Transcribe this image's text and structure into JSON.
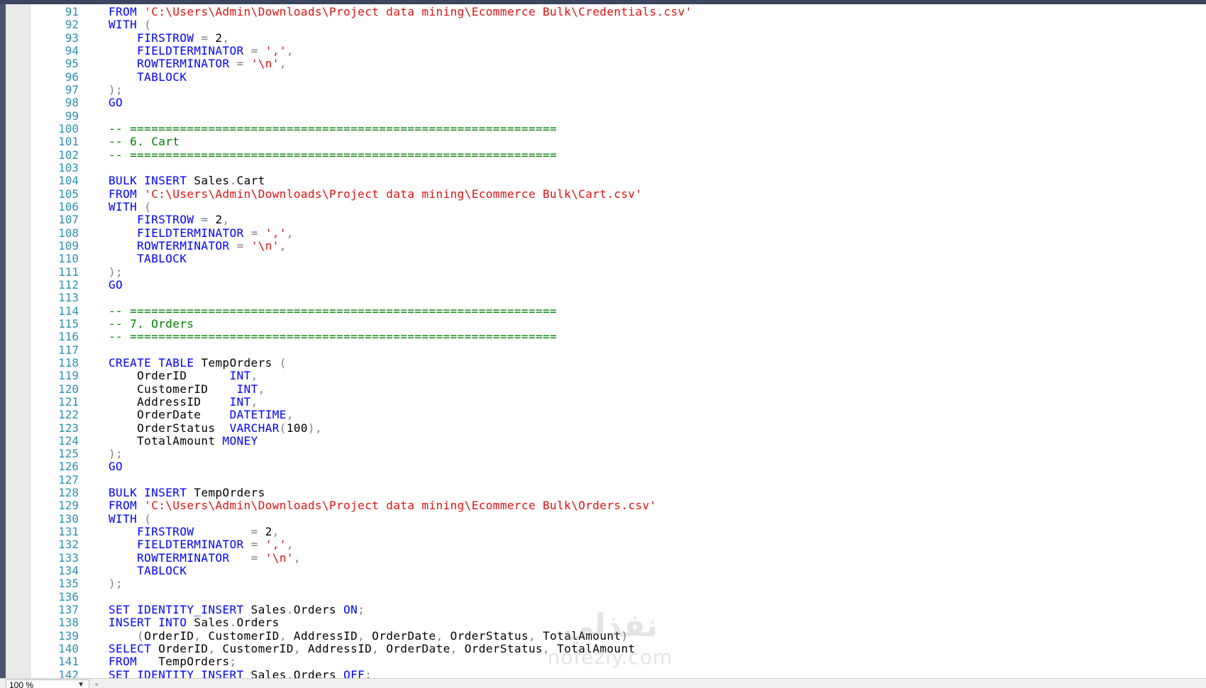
{
  "editor": {
    "lines": [
      {
        "n": "91",
        "tokens": [
          [
            "kw",
            "FROM"
          ],
          [
            "id",
            " "
          ],
          [
            "str",
            "'C:\\Users\\Admin\\Downloads\\Project data mining\\Ecommerce Bulk\\Credentials.csv'"
          ]
        ]
      },
      {
        "n": "92",
        "tokens": [
          [
            "kw",
            "WITH"
          ],
          [
            "id",
            " "
          ],
          [
            "op",
            "("
          ]
        ]
      },
      {
        "n": "93",
        "tokens": [
          [
            "id",
            "    "
          ],
          [
            "kw",
            "FIRSTROW"
          ],
          [
            "id",
            " "
          ],
          [
            "op",
            "="
          ],
          [
            "id",
            " 2"
          ],
          [
            "op",
            ","
          ]
        ]
      },
      {
        "n": "94",
        "tokens": [
          [
            "id",
            "    "
          ],
          [
            "kw",
            "FIELDTERMINATOR"
          ],
          [
            "id",
            " "
          ],
          [
            "op",
            "="
          ],
          [
            "id",
            " "
          ],
          [
            "str",
            "','"
          ],
          [
            "op",
            ","
          ]
        ]
      },
      {
        "n": "95",
        "tokens": [
          [
            "id",
            "    "
          ],
          [
            "kw",
            "ROWTERMINATOR"
          ],
          [
            "id",
            " "
          ],
          [
            "op",
            "="
          ],
          [
            "id",
            " "
          ],
          [
            "str",
            "'\\n'"
          ],
          [
            "op",
            ","
          ]
        ]
      },
      {
        "n": "96",
        "tokens": [
          [
            "id",
            "    "
          ],
          [
            "kw",
            "TABLOCK"
          ]
        ]
      },
      {
        "n": "97",
        "tokens": [
          [
            "op",
            ");"
          ]
        ]
      },
      {
        "n": "98",
        "tokens": [
          [
            "kw",
            "GO"
          ]
        ]
      },
      {
        "n": "99",
        "tokens": []
      },
      {
        "n": "100",
        "tokens": [
          [
            "cm",
            "-- ============================================================"
          ]
        ]
      },
      {
        "n": "101",
        "tokens": [
          [
            "cm",
            "-- 6. Cart"
          ]
        ]
      },
      {
        "n": "102",
        "tokens": [
          [
            "cm",
            "-- ============================================================"
          ]
        ]
      },
      {
        "n": "103",
        "tokens": []
      },
      {
        "n": "104",
        "tokens": [
          [
            "kw",
            "BULK INSERT"
          ],
          [
            "id",
            " Sales"
          ],
          [
            "op",
            "."
          ],
          [
            "id",
            "Cart"
          ]
        ]
      },
      {
        "n": "105",
        "tokens": [
          [
            "kw",
            "FROM"
          ],
          [
            "id",
            " "
          ],
          [
            "str",
            "'C:\\Users\\Admin\\Downloads\\Project data mining\\Ecommerce Bulk\\Cart.csv'"
          ]
        ]
      },
      {
        "n": "106",
        "tokens": [
          [
            "kw",
            "WITH"
          ],
          [
            "id",
            " "
          ],
          [
            "op",
            "("
          ]
        ]
      },
      {
        "n": "107",
        "tokens": [
          [
            "id",
            "    "
          ],
          [
            "kw",
            "FIRSTROW"
          ],
          [
            "id",
            " "
          ],
          [
            "op",
            "="
          ],
          [
            "id",
            " 2"
          ],
          [
            "op",
            ","
          ]
        ]
      },
      {
        "n": "108",
        "tokens": [
          [
            "id",
            "    "
          ],
          [
            "kw",
            "FIELDTERMINATOR"
          ],
          [
            "id",
            " "
          ],
          [
            "op",
            "="
          ],
          [
            "id",
            " "
          ],
          [
            "str",
            "','"
          ],
          [
            "op",
            ","
          ]
        ]
      },
      {
        "n": "109",
        "tokens": [
          [
            "id",
            "    "
          ],
          [
            "kw",
            "ROWTERMINATOR"
          ],
          [
            "id",
            " "
          ],
          [
            "op",
            "="
          ],
          [
            "id",
            " "
          ],
          [
            "str",
            "'\\n'"
          ],
          [
            "op",
            ","
          ]
        ]
      },
      {
        "n": "110",
        "tokens": [
          [
            "id",
            "    "
          ],
          [
            "kw",
            "TABLOCK"
          ]
        ]
      },
      {
        "n": "111",
        "tokens": [
          [
            "op",
            ");"
          ]
        ]
      },
      {
        "n": "112",
        "tokens": [
          [
            "kw",
            "GO"
          ]
        ]
      },
      {
        "n": "113",
        "tokens": []
      },
      {
        "n": "114",
        "tokens": [
          [
            "cm",
            "-- ============================================================"
          ]
        ]
      },
      {
        "n": "115",
        "tokens": [
          [
            "cm",
            "-- 7. Orders"
          ]
        ]
      },
      {
        "n": "116",
        "tokens": [
          [
            "cm",
            "-- ============================================================"
          ]
        ]
      },
      {
        "n": "117",
        "tokens": []
      },
      {
        "n": "118",
        "tokens": [
          [
            "kw",
            "CREATE TABLE"
          ],
          [
            "id",
            " TempOrders "
          ],
          [
            "op",
            "("
          ]
        ]
      },
      {
        "n": "119",
        "tokens": [
          [
            "id",
            "    OrderID      "
          ],
          [
            "kw",
            "INT"
          ],
          [
            "op",
            ","
          ]
        ]
      },
      {
        "n": "120",
        "tokens": [
          [
            "id",
            "    CustomerID    "
          ],
          [
            "kw",
            "INT"
          ],
          [
            "op",
            ","
          ]
        ]
      },
      {
        "n": "121",
        "tokens": [
          [
            "id",
            "    AddressID    "
          ],
          [
            "kw",
            "INT"
          ],
          [
            "op",
            ","
          ]
        ]
      },
      {
        "n": "122",
        "tokens": [
          [
            "id",
            "    OrderDate    "
          ],
          [
            "kw",
            "DATETIME"
          ],
          [
            "op",
            ","
          ]
        ]
      },
      {
        "n": "123",
        "tokens": [
          [
            "id",
            "    OrderStatus  "
          ],
          [
            "kw",
            "VARCHAR"
          ],
          [
            "op",
            "("
          ],
          [
            "id",
            "100"
          ],
          [
            "op",
            "),"
          ]
        ]
      },
      {
        "n": "124",
        "tokens": [
          [
            "id",
            "    TotalAmount "
          ],
          [
            "kw",
            "MONEY"
          ]
        ]
      },
      {
        "n": "125",
        "tokens": [
          [
            "op",
            ");"
          ]
        ]
      },
      {
        "n": "126",
        "tokens": [
          [
            "kw",
            "GO"
          ]
        ]
      },
      {
        "n": "127",
        "tokens": []
      },
      {
        "n": "128",
        "tokens": [
          [
            "kw",
            "BULK INSERT"
          ],
          [
            "id",
            " TempOrders"
          ]
        ]
      },
      {
        "n": "129",
        "tokens": [
          [
            "kw",
            "FROM"
          ],
          [
            "id",
            " "
          ],
          [
            "str",
            "'C:\\Users\\Admin\\Downloads\\Project data mining\\Ecommerce Bulk\\Orders.csv'"
          ]
        ]
      },
      {
        "n": "130",
        "tokens": [
          [
            "kw",
            "WITH"
          ],
          [
            "id",
            " "
          ],
          [
            "op",
            "("
          ]
        ]
      },
      {
        "n": "131",
        "tokens": [
          [
            "id",
            "    "
          ],
          [
            "kw",
            "FIRSTROW"
          ],
          [
            "id",
            "        "
          ],
          [
            "op",
            "="
          ],
          [
            "id",
            " 2"
          ],
          [
            "op",
            ","
          ]
        ]
      },
      {
        "n": "132",
        "tokens": [
          [
            "id",
            "    "
          ],
          [
            "kw",
            "FIELDTERMINATOR"
          ],
          [
            "id",
            " "
          ],
          [
            "op",
            "="
          ],
          [
            "id",
            " "
          ],
          [
            "str",
            "','"
          ],
          [
            "op",
            ","
          ]
        ]
      },
      {
        "n": "133",
        "tokens": [
          [
            "id",
            "    "
          ],
          [
            "kw",
            "ROWTERMINATOR"
          ],
          [
            "id",
            "   "
          ],
          [
            "op",
            "="
          ],
          [
            "id",
            " "
          ],
          [
            "str",
            "'\\n'"
          ],
          [
            "op",
            ","
          ]
        ]
      },
      {
        "n": "134",
        "tokens": [
          [
            "id",
            "    "
          ],
          [
            "kw",
            "TABLOCK"
          ]
        ]
      },
      {
        "n": "135",
        "tokens": [
          [
            "op",
            ");"
          ]
        ]
      },
      {
        "n": "136",
        "tokens": []
      },
      {
        "n": "137",
        "tokens": [
          [
            "kw",
            "SET IDENTITY_INSERT"
          ],
          [
            "id",
            " Sales"
          ],
          [
            "op",
            "."
          ],
          [
            "id",
            "Orders "
          ],
          [
            "kw",
            "ON"
          ],
          [
            "op",
            ";"
          ]
        ]
      },
      {
        "n": "138",
        "tokens": [
          [
            "kw",
            "INSERT INTO"
          ],
          [
            "id",
            " Sales"
          ],
          [
            "op",
            "."
          ],
          [
            "id",
            "Orders"
          ]
        ]
      },
      {
        "n": "139",
        "tokens": [
          [
            "id",
            "    "
          ],
          [
            "op",
            "("
          ],
          [
            "id",
            "OrderID"
          ],
          [
            "op",
            ","
          ],
          [
            "id",
            " CustomerID"
          ],
          [
            "op",
            ","
          ],
          [
            "id",
            " AddressID"
          ],
          [
            "op",
            ","
          ],
          [
            "id",
            " OrderDate"
          ],
          [
            "op",
            ","
          ],
          [
            "id",
            " OrderStatus"
          ],
          [
            "op",
            ","
          ],
          [
            "id",
            " TotalAmount"
          ],
          [
            "op",
            ")"
          ]
        ]
      },
      {
        "n": "140",
        "tokens": [
          [
            "kw",
            "SELECT"
          ],
          [
            "id",
            " OrderID"
          ],
          [
            "op",
            ","
          ],
          [
            "id",
            " CustomerID"
          ],
          [
            "op",
            ","
          ],
          [
            "id",
            " AddressID"
          ],
          [
            "op",
            ","
          ],
          [
            "id",
            " OrderDate"
          ],
          [
            "op",
            ","
          ],
          [
            "id",
            " OrderStatus"
          ],
          [
            "op",
            ","
          ],
          [
            "id",
            " TotalAmount"
          ]
        ]
      },
      {
        "n": "141",
        "tokens": [
          [
            "kw",
            "FROM"
          ],
          [
            "id",
            "   TempOrders"
          ],
          [
            "op",
            ";"
          ]
        ]
      },
      {
        "n": "142",
        "tokens": [
          [
            "kw",
            "SET IDENTITY_INSERT"
          ],
          [
            "id",
            " Sales"
          ],
          [
            "op",
            "."
          ],
          [
            "id",
            "Orders "
          ],
          [
            "kw",
            "OFF"
          ],
          [
            "op",
            ";"
          ]
        ]
      }
    ]
  },
  "status_bar": {
    "zoom_value": "100 %",
    "zoom_arrow": "▼",
    "scroll_left_arrow": "◂"
  },
  "watermark": {
    "logo_text": "نفذلي",
    "site_text": "nofezly.com"
  },
  "colors": {
    "keyword": "#0000ff",
    "string": "#e01010",
    "comment": "#008000",
    "operator": "#808080",
    "line_number": "#2b91af"
  }
}
